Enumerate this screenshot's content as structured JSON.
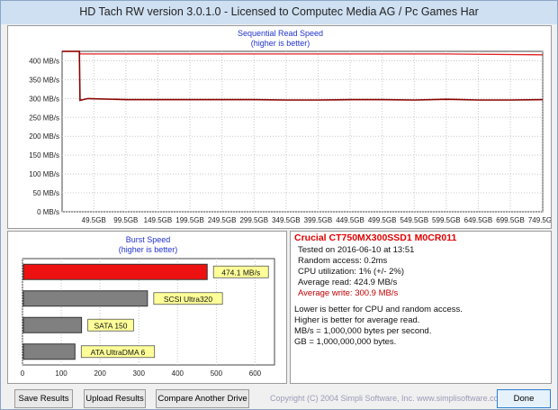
{
  "window": {
    "title": "HD Tach RW version 3.0.1.0 - Licensed to Computec Media AG / Pc Games Har"
  },
  "sequential": {
    "title": "Sequential Read Speed",
    "subtitle": "(higher is better)"
  },
  "burst": {
    "title": "Burst Speed",
    "subtitle": "(higher is better)"
  },
  "chart_data": [
    {
      "type": "line",
      "title": "Sequential Read Speed",
      "subtitle": "(higher is better)",
      "y_unit": "MB/s",
      "ylim": [
        0,
        425
      ],
      "yticks": [
        0,
        50,
        100,
        150,
        200,
        250,
        300,
        350,
        400
      ],
      "ytick_labels": [
        "0 MB/s",
        "50 MB/s",
        "100 MB/s",
        "150 MB/s",
        "200 MB/s",
        "250 MB/s",
        "300 MB/s",
        "350 MB/s",
        "400 MB/s"
      ],
      "xlim": [
        0,
        750
      ],
      "xticks": [
        49.5,
        99.5,
        149.5,
        199.5,
        249.5,
        299.5,
        349.5,
        399.5,
        449.5,
        499.5,
        549.5,
        599.5,
        649.5,
        699.5,
        749.5
      ],
      "xtick_labels": [
        "49.5GB",
        "99.5GB",
        "149.5GB",
        "199.5GB",
        "249.5GB",
        "299.5GB",
        "349.5GB",
        "399.5GB",
        "449.5GB",
        "499.5GB",
        "549.5GB",
        "599.5GB",
        "649.5GB",
        "699.5GB",
        "749.5GB"
      ],
      "grid": true,
      "series": [
        {
          "color": "#e02020",
          "x": [
            0,
            27,
            28,
            100,
            200,
            300,
            350,
            400,
            500,
            600,
            750
          ],
          "y": [
            425,
            425,
            418,
            418,
            418,
            418,
            418,
            418,
            418,
            418,
            416
          ]
        },
        {
          "color": "#8b0000",
          "x": [
            0,
            27,
            28,
            40,
            100,
            200,
            300,
            350,
            400,
            450,
            500,
            550,
            600,
            650,
            700,
            750
          ],
          "y": [
            425,
            425,
            295,
            300,
            297,
            297,
            297,
            296,
            296,
            297,
            297,
            296,
            298,
            296,
            296,
            297
          ]
        }
      ]
    },
    {
      "type": "bar",
      "orientation": "horizontal",
      "title": "Burst Speed",
      "subtitle": "(higher is better)",
      "xlim": [
        0,
        650
      ],
      "xticks": [
        0,
        100,
        200,
        300,
        400,
        500,
        600
      ],
      "categories": [
        "474.1 MB/s",
        "SCSI Ultra320",
        "SATA 150",
        "ATA UltraDMA 6"
      ],
      "values": [
        474.1,
        320,
        150,
        133
      ],
      "colors": [
        "#ee1111",
        "#808080",
        "#808080",
        "#808080"
      ]
    }
  ],
  "info": {
    "drive": "Crucial CT750MX300SSD1 M0CR011",
    "tested": "Tested on 2016-06-10 at 13:51",
    "random_access": "Random access: 0.2ms",
    "cpu": "CPU utilization: 1% (+/- 2%)",
    "avg_read": "Average read: 424.9 MB/s",
    "avg_write": "Average write: 300.9 MB/s",
    "note1": "Lower is better for CPU and random access.",
    "note2": "Higher is better for average read.",
    "note3": "MB/s = 1,000,000 bytes per second.",
    "note4": "GB = 1,000,000,000 bytes."
  },
  "buttons": {
    "save": "Save Results",
    "upload": "Upload Results",
    "compare": "Compare Another Drive",
    "done": "Done"
  },
  "footer": {
    "copyright": "Copyright (C) 2004 Simpli Software, Inc. www.simplisoftware.com"
  }
}
